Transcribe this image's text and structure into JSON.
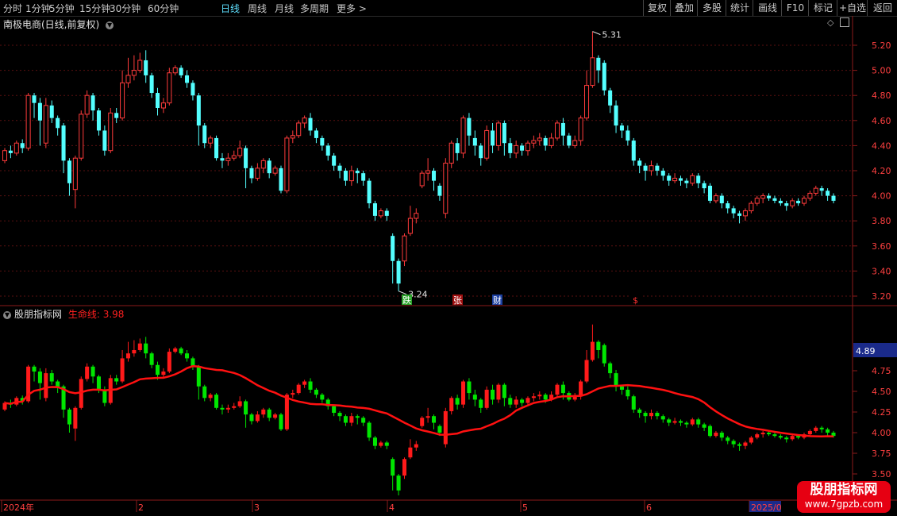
{
  "toolbar": {
    "periods": [
      "分时",
      "1分钟",
      "5分钟",
      "15分钟",
      "30分钟",
      "60分钟",
      "日线",
      "周线",
      "月线",
      "多周期",
      "更多 >"
    ],
    "active_period": "日线",
    "buttons": [
      "复权",
      "叠加",
      "多股",
      "统计",
      "画线",
      "F10",
      "标记",
      "+自选",
      "返回"
    ]
  },
  "main": {
    "title": "南极电商(日线,前复权)",
    "y_ticks": [
      "5.20",
      "5.00",
      "4.80",
      "4.60",
      "4.40",
      "4.20",
      "4.00",
      "3.80",
      "3.60",
      "3.40",
      "3.20"
    ],
    "high_label": "5.31",
    "low_label": "3.24",
    "markers": [
      {
        "text": "跌",
        "bg": "#2aa32a",
        "fg": "#ffffff"
      },
      {
        "text": "张",
        "bg": "#a01010",
        "fg": "#ffffff"
      },
      {
        "text": "财",
        "bg": "#1c3fa0",
        "fg": "#ffffff"
      },
      {
        "text": "$",
        "bg": "#000000",
        "fg": "#ff3030"
      }
    ]
  },
  "sub": {
    "title": "股朋指标网",
    "lifeline_label": "生命线: 3.98",
    "y_ticks": [
      "4.75",
      "4.50",
      "4.25",
      "4.00",
      "3.75",
      "3.50"
    ],
    "current_value": "4.89"
  },
  "xaxis": {
    "labels": [
      "2024年",
      "2",
      "3",
      "4",
      "5",
      "6",
      "2025/0"
    ]
  },
  "watermark": {
    "cn": "股朋指标网",
    "url": "www.7gpzb.com"
  },
  "colors": {
    "up": "#ff3b3b",
    "down": "#54ffff",
    "green": "#00e600",
    "red": "#ff1a1a",
    "line": "#ff1111",
    "accent": "#5fe0ff"
  },
  "candles": [
    [
      4.28,
      4.36,
      4.26,
      4.38
    ],
    [
      4.36,
      4.34,
      4.3,
      4.4
    ],
    [
      4.34,
      4.42,
      4.32,
      4.44
    ],
    [
      4.42,
      4.38,
      4.34,
      4.45
    ],
    [
      4.38,
      4.8,
      4.36,
      4.82
    ],
    [
      4.8,
      4.74,
      4.62,
      4.82
    ],
    [
      4.74,
      4.6,
      4.4,
      4.78
    ],
    [
      4.42,
      4.72,
      4.38,
      4.78
    ],
    [
      4.72,
      4.62,
      4.58,
      4.76
    ],
    [
      4.62,
      4.54,
      4.48,
      4.64
    ],
    [
      4.56,
      4.28,
      4.18,
      4.58
    ],
    [
      4.28,
      4.1,
      4.0,
      4.3
    ],
    [
      4.05,
      4.3,
      3.9,
      4.32
    ],
    [
      4.3,
      4.65,
      4.28,
      4.68
    ],
    [
      4.65,
      4.8,
      4.62,
      4.84
    ],
    [
      4.8,
      4.68,
      4.6,
      4.82
    ],
    [
      4.68,
      4.52,
      4.48,
      4.7
    ],
    [
      4.52,
      4.36,
      4.32,
      4.56
    ],
    [
      4.36,
      4.66,
      4.34,
      4.7
    ],
    [
      4.66,
      4.62,
      4.58,
      4.7
    ],
    [
      4.62,
      4.9,
      4.6,
      5.0
    ],
    [
      4.9,
      4.96,
      4.86,
      5.1
    ],
    [
      4.96,
      5.0,
      4.92,
      5.12
    ],
    [
      5.0,
      5.08,
      4.98,
      5.14
    ],
    [
      5.08,
      4.96,
      4.9,
      5.16
    ],
    [
      4.96,
      4.82,
      4.78,
      4.98
    ],
    [
      4.82,
      4.7,
      4.64,
      4.86
    ],
    [
      4.7,
      4.74,
      4.66,
      4.78
    ],
    [
      4.74,
      4.98,
      4.72,
      5.02
    ],
    [
      4.98,
      5.02,
      4.96,
      5.04
    ],
    [
      5.02,
      4.96,
      4.94,
      5.04
    ],
    [
      4.96,
      4.9,
      4.86,
      5.0
    ],
    [
      4.9,
      4.8,
      4.76,
      4.92
    ],
    [
      4.8,
      4.56,
      4.4,
      4.82
    ],
    [
      4.56,
      4.42,
      4.38,
      4.58
    ],
    [
      4.42,
      4.46,
      4.38,
      4.48
    ],
    [
      4.46,
      4.3,
      4.28,
      4.48
    ],
    [
      4.3,
      4.28,
      4.22,
      4.34
    ],
    [
      4.28,
      4.3,
      4.24,
      4.34
    ],
    [
      4.3,
      4.32,
      4.28,
      4.36
    ],
    [
      4.32,
      4.38,
      4.3,
      4.44
    ],
    [
      4.38,
      4.22,
      4.06,
      4.4
    ],
    [
      4.22,
      4.14,
      4.1,
      4.24
    ],
    [
      4.14,
      4.22,
      4.12,
      4.26
    ],
    [
      4.22,
      4.28,
      4.18,
      4.3
    ],
    [
      4.28,
      4.18,
      4.14,
      4.3
    ],
    [
      4.18,
      4.22,
      4.16,
      4.24
    ],
    [
      4.22,
      4.04,
      4.02,
      4.24
    ],
    [
      4.04,
      4.46,
      4.02,
      4.48
    ],
    [
      4.46,
      4.48,
      4.42,
      4.52
    ],
    [
      4.48,
      4.58,
      4.46,
      4.6
    ],
    [
      4.58,
      4.62,
      4.54,
      4.64
    ],
    [
      4.62,
      4.52,
      4.48,
      4.66
    ],
    [
      4.52,
      4.46,
      4.42,
      4.54
    ],
    [
      4.46,
      4.4,
      4.36,
      4.48
    ],
    [
      4.4,
      4.32,
      4.28,
      4.42
    ],
    [
      4.32,
      4.24,
      4.2,
      4.34
    ],
    [
      4.24,
      4.2,
      4.14,
      4.26
    ],
    [
      4.2,
      4.12,
      4.08,
      4.22
    ],
    [
      4.12,
      4.2,
      4.08,
      4.24
    ],
    [
      4.2,
      4.18,
      4.1,
      4.22
    ],
    [
      4.18,
      4.12,
      4.08,
      4.2
    ],
    [
      4.12,
      3.94,
      3.9,
      4.14
    ],
    [
      3.94,
      3.84,
      3.8,
      3.96
    ],
    [
      3.84,
      3.88,
      3.82,
      3.9
    ],
    [
      3.88,
      3.84,
      3.8,
      3.9
    ],
    [
      3.68,
      3.48,
      3.3,
      3.7
    ],
    [
      3.48,
      3.3,
      3.24,
      3.5
    ],
    [
      3.48,
      3.68,
      3.44,
      3.7
    ],
    [
      3.7,
      3.82,
      3.68,
      3.92
    ],
    [
      3.82,
      3.86,
      3.78,
      3.9
    ],
    [
      4.08,
      4.18,
      4.06,
      4.2
    ],
    [
      4.18,
      4.2,
      4.12,
      4.3
    ],
    [
      4.2,
      4.12,
      4.04,
      4.22
    ],
    [
      4.08,
      4.0,
      3.96,
      4.1
    ],
    [
      3.86,
      4.26,
      3.82,
      4.3
    ],
    [
      4.26,
      4.42,
      4.22,
      4.44
    ],
    [
      4.42,
      4.34,
      4.28,
      4.46
    ],
    [
      4.34,
      4.62,
      4.3,
      4.64
    ],
    [
      4.62,
      4.48,
      4.4,
      4.66
    ],
    [
      4.46,
      4.4,
      4.32,
      4.52
    ],
    [
      4.4,
      4.3,
      4.24,
      4.42
    ],
    [
      4.3,
      4.52,
      4.28,
      4.56
    ],
    [
      4.52,
      4.4,
      4.34,
      4.58
    ],
    [
      4.4,
      4.58,
      4.36,
      4.6
    ],
    [
      4.58,
      4.42,
      4.32,
      4.6
    ],
    [
      4.42,
      4.34,
      4.3,
      4.46
    ],
    [
      4.34,
      4.4,
      4.3,
      4.44
    ],
    [
      4.4,
      4.36,
      4.32,
      4.42
    ],
    [
      4.36,
      4.42,
      4.32,
      4.44
    ],
    [
      4.42,
      4.44,
      4.38,
      4.48
    ],
    [
      4.44,
      4.46,
      4.4,
      4.5
    ],
    [
      4.46,
      4.4,
      4.36,
      4.48
    ],
    [
      4.4,
      4.46,
      4.38,
      4.5
    ],
    [
      4.46,
      4.58,
      4.44,
      4.6
    ],
    [
      4.58,
      4.48,
      4.4,
      4.62
    ],
    [
      4.48,
      4.4,
      4.38,
      4.5
    ],
    [
      4.4,
      4.44,
      4.38,
      4.48
    ],
    [
      4.44,
      4.62,
      4.4,
      4.64
    ],
    [
      4.62,
      4.88,
      4.6,
      5.0
    ],
    [
      4.88,
      5.1,
      4.86,
      5.31
    ],
    [
      5.1,
      5.0,
      4.9,
      5.12
    ],
    [
      5.06,
      4.84,
      4.8,
      5.08
    ],
    [
      4.84,
      4.72,
      4.66,
      4.86
    ],
    [
      4.72,
      4.56,
      4.5,
      4.76
    ],
    [
      4.56,
      4.52,
      4.46,
      4.58
    ],
    [
      4.52,
      4.44,
      4.4,
      4.56
    ],
    [
      4.44,
      4.28,
      4.24,
      4.46
    ],
    [
      4.28,
      4.24,
      4.18,
      4.3
    ],
    [
      4.24,
      4.2,
      4.12,
      4.26
    ],
    [
      4.2,
      4.24,
      4.16,
      4.28
    ],
    [
      4.24,
      4.2,
      4.16,
      4.26
    ],
    [
      4.2,
      4.16,
      4.12,
      4.22
    ],
    [
      4.16,
      4.12,
      4.08,
      4.18
    ],
    [
      4.12,
      4.14,
      4.1,
      4.18
    ],
    [
      4.14,
      4.12,
      4.08,
      4.16
    ],
    [
      4.12,
      4.1,
      4.06,
      4.14
    ],
    [
      4.1,
      4.16,
      4.08,
      4.18
    ],
    [
      4.16,
      4.1,
      4.06,
      4.18
    ],
    [
      4.1,
      4.06,
      4.02,
      4.12
    ],
    [
      4.08,
      3.96,
      3.94,
      4.1
    ],
    [
      3.96,
      4.0,
      3.94,
      4.02
    ],
    [
      4.0,
      3.94,
      3.9,
      4.02
    ],
    [
      3.94,
      3.9,
      3.86,
      3.96
    ],
    [
      3.9,
      3.86,
      3.82,
      3.92
    ],
    [
      3.86,
      3.84,
      3.78,
      3.88
    ],
    [
      3.84,
      3.88,
      3.8,
      3.9
    ],
    [
      3.88,
      3.94,
      3.86,
      3.96
    ],
    [
      3.94,
      3.98,
      3.92,
      4.0
    ],
    [
      3.98,
      4.0,
      3.94,
      4.02
    ],
    [
      4.0,
      3.98,
      3.96,
      4.02
    ],
    [
      3.98,
      3.96,
      3.94,
      4.0
    ],
    [
      3.96,
      3.94,
      3.92,
      3.98
    ],
    [
      3.94,
      3.92,
      3.88,
      3.96
    ],
    [
      3.92,
      3.96,
      3.9,
      3.98
    ],
    [
      3.96,
      3.94,
      3.92,
      3.98
    ],
    [
      3.94,
      3.98,
      3.92,
      4.0
    ],
    [
      3.98,
      4.02,
      3.96,
      4.04
    ],
    [
      4.02,
      4.06,
      4.0,
      4.08
    ],
    [
      4.06,
      4.04,
      4.0,
      4.08
    ],
    [
      4.04,
      4.0,
      3.96,
      4.06
    ],
    [
      4.0,
      3.96,
      3.94,
      4.02
    ]
  ]
}
